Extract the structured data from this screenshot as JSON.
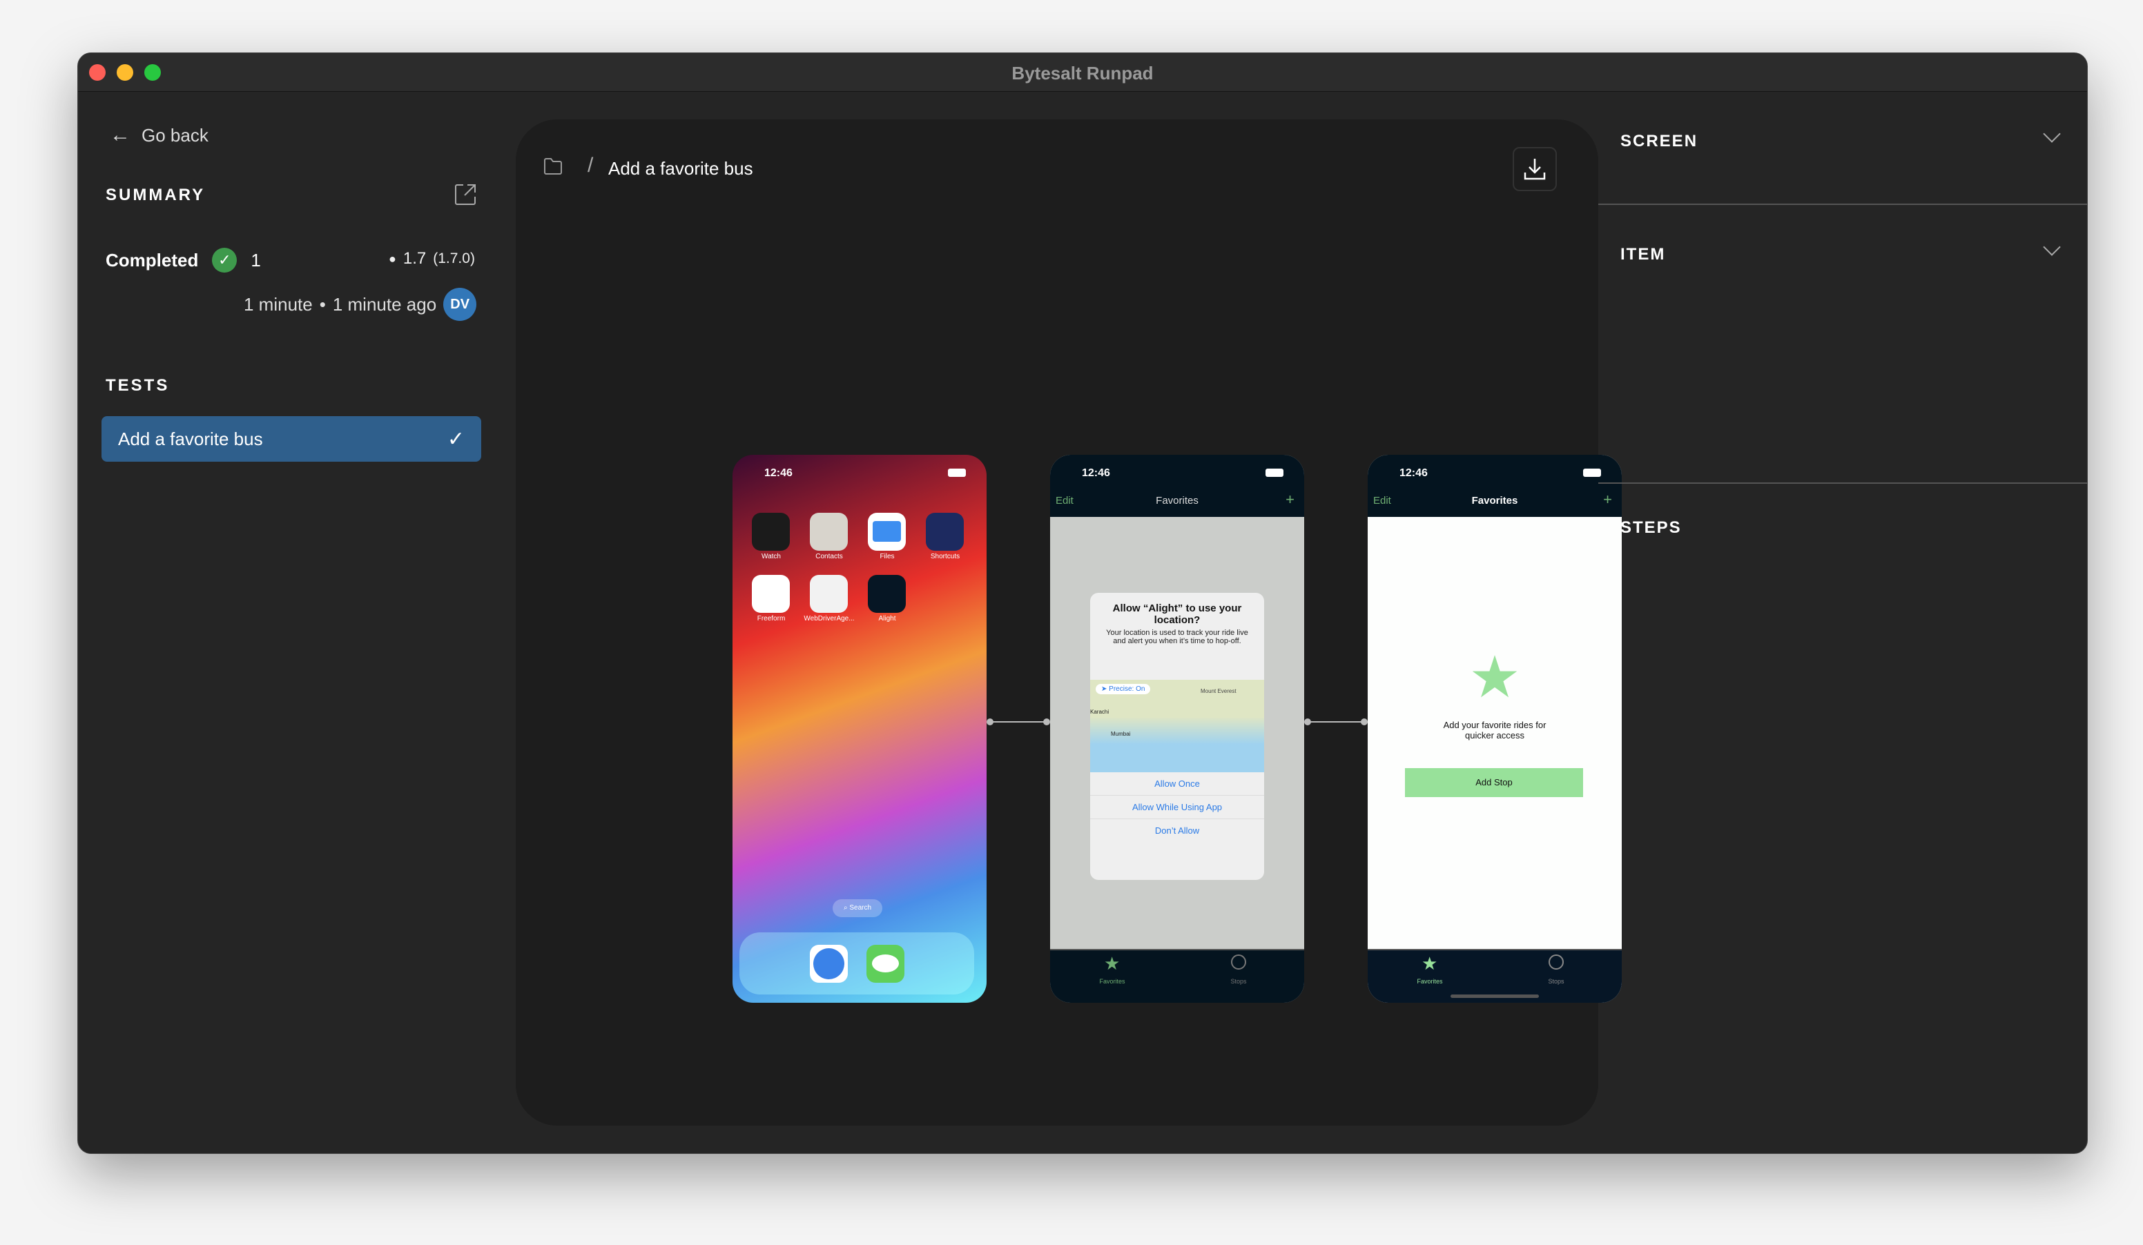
{
  "window": {
    "title": "Bytesalt Runpad"
  },
  "sidebar": {
    "go_back": "Go back",
    "summary_heading": "SUMMARY",
    "status": "Completed",
    "passed_count": "1",
    "app_version": "1.7",
    "app_build": "(1.7.0)",
    "duration": "1 minute",
    "separator": "•",
    "time_ago": "1 minute ago",
    "avatar_initials": "DV",
    "tests_heading": "TESTS",
    "tests": [
      {
        "label": "Add a favorite bus",
        "status": "passed"
      }
    ]
  },
  "main": {
    "breadcrumb_sep": "/",
    "breadcrumb_title": "Add a favorite bus"
  },
  "phones": {
    "time": "12:46",
    "home": {
      "apps": [
        "Watch",
        "Contacts",
        "Files",
        "Shortcuts",
        "Freeform",
        "WebDriverAge...",
        "Alight"
      ],
      "search": "Search"
    },
    "nav": {
      "edit": "Edit",
      "title": "Favorites",
      "add": "+"
    },
    "alert": {
      "title": "Allow “Alight” to use your location?",
      "message": "Your location is used to track your ride live and alert you when it’s time to hop-off.",
      "precise": "Precise: On",
      "map_labels": [
        "Mount Everest",
        "Karachi",
        "Mumbai"
      ],
      "buttons": [
        "Allow Once",
        "Allow While Using App",
        "Don’t Allow"
      ]
    },
    "favorites": {
      "empty_text": "Add your favorite rides for quicker access",
      "add_stop": "Add Stop"
    },
    "tabs": [
      "Favorites",
      "Stops"
    ]
  },
  "right": {
    "sections": [
      "SCREEN",
      "ITEM",
      "STEPS"
    ]
  },
  "colors": {
    "accent_blue": "#2f5f8c",
    "success": "#3e9a4c",
    "app_green": "#98e19a",
    "avatar": "#3277b8"
  }
}
